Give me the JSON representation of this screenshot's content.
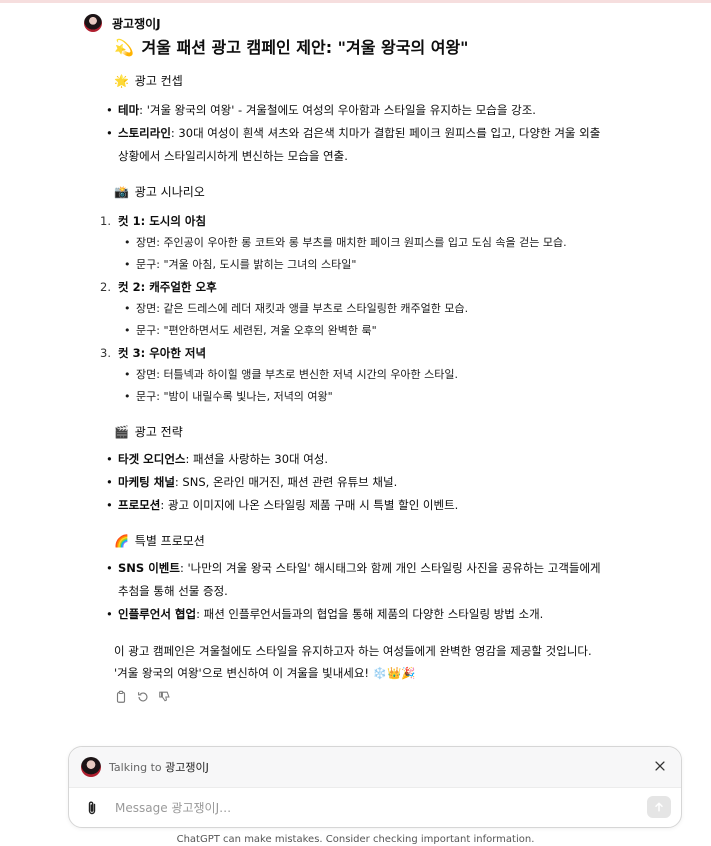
{
  "author": "광고쟁이J",
  "title_emoji": "💫",
  "title": "겨울 패션 광고 캠페인 제안: \"겨울 왕국의 여왕\"",
  "concept": {
    "emoji": "🌟",
    "heading": "광고 컨셉",
    "items": [
      {
        "label": "테마",
        "text": ": '겨울 왕국의 여왕' - 겨울철에도 여성의 우아함과 스타일을 유지하는 모습을 강조."
      },
      {
        "label": "스토리라인",
        "text": ": 30대 여성이 흰색 셔츠와 검은색 치마가 결합된 페이크 원피스를 입고, 다양한 겨울 외출 상황에서 스타일리시하게 변신하는 모습을 연출."
      }
    ]
  },
  "scenario": {
    "emoji": "📸",
    "heading": "광고 시나리오",
    "scenes": [
      {
        "num": "1.",
        "title": "컷 1: 도시의 아침",
        "scene": "장면: 주인공이 우아한 롱 코트와 롱 부츠를 매치한 페이크 원피스를 입고 도심 속을 걷는 모습.",
        "copy": "문구: \"겨울 아침, 도시를 밝히는 그녀의 스타일\""
      },
      {
        "num": "2.",
        "title": "컷 2: 캐주얼한 오후",
        "scene": "장면: 같은 드레스에 레더 재킷과 앵클 부츠로 스타일링한 캐주얼한 모습.",
        "copy": "문구: \"편안하면서도 세련된, 겨울 오후의 완벽한 룩\""
      },
      {
        "num": "3.",
        "title": "컷 3: 우아한 저녁",
        "scene": "장면: 터틀넥과 하이힐 앵클 부츠로 변신한 저녁 시간의 우아한 스타일.",
        "copy": "문구: \"밤이 내릴수록 빛나는, 저녁의 여왕\""
      }
    ]
  },
  "strategy": {
    "emoji": "🎬",
    "heading": "광고 전략",
    "items": [
      {
        "label": "타겟 오디언스",
        "text": ": 패션을 사랑하는 30대 여성."
      },
      {
        "label": "마케팅 채널",
        "text": ": SNS, 온라인 매거진, 패션 관련 유튜브 채널."
      },
      {
        "label": "프로모션",
        "text": ": 광고 이미지에 나온 스타일링 제품 구매 시 특별 할인 이벤트."
      }
    ]
  },
  "promotion": {
    "emoji": "🌈",
    "heading": "특별 프로모션",
    "items": [
      {
        "label": "SNS 이벤트",
        "text": ": '나만의 겨울 왕국 스타일' 해시태그와 함께 개인 스타일링 사진을 공유하는 고객들에게 추첨을 통해 선물 증정."
      },
      {
        "label": "인플루언서 협업",
        "text": ": 패션 인플루언서들과의 협업을 통해 제품의 다양한 스타일링 방법 소개."
      }
    ]
  },
  "closing": {
    "line1": "이 광고 캠페인은 겨울철에도 스타일을 유지하고자 하는 여성들에게 완벽한 영감을 제공할 것입니다.",
    "line2": "'겨울 왕국의 여왕'으로 변신하여 이 겨울을 빛내세요! ❄️👑🎉"
  },
  "composer": {
    "talking_prefix": "Talking to",
    "talking_name": "광고쟁이J",
    "placeholder": "Message 광고쟁이J…"
  },
  "footer": "ChatGPT can make mistakes. Consider checking important information.",
  "icons": [
    "copy-icon",
    "regenerate-icon",
    "thumbs-down-icon",
    "close-icon",
    "paperclip-icon",
    "arrow-up-icon"
  ]
}
